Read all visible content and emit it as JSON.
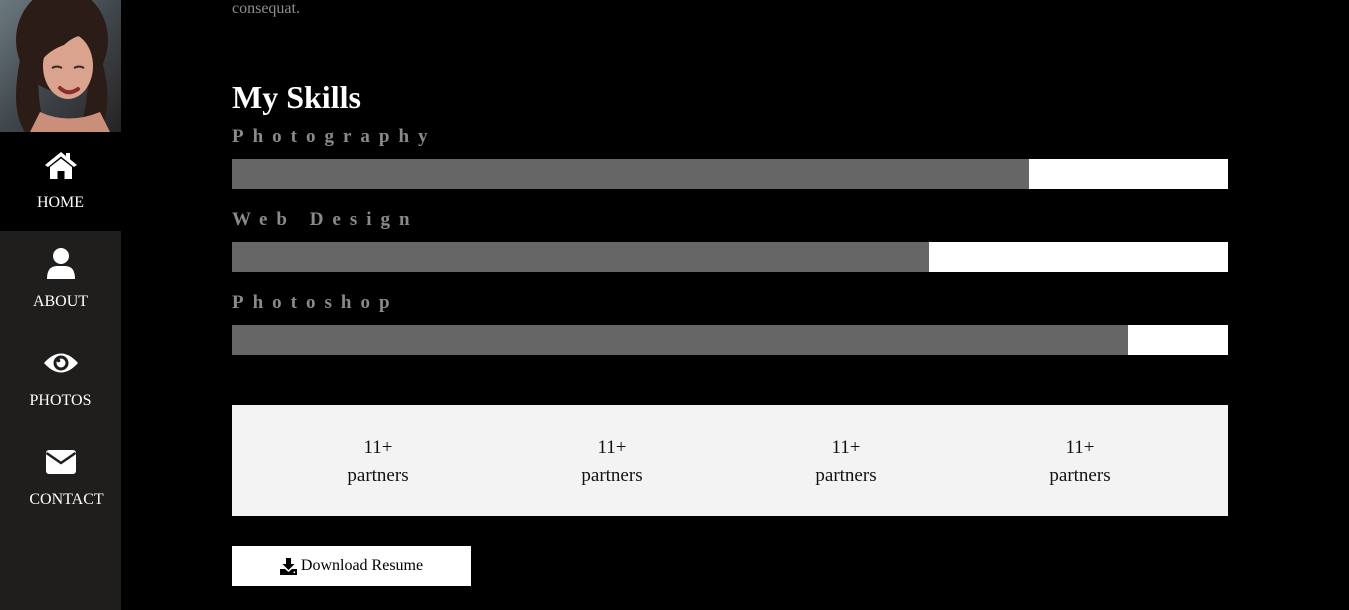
{
  "sidebar": {
    "avatar_alt": "Profile photo",
    "items": [
      {
        "label": "HOME",
        "icon": "home-icon",
        "active": true
      },
      {
        "label": "ABOUT",
        "icon": "user-icon",
        "active": false
      },
      {
        "label": "PHOTOS",
        "icon": "eye-icon",
        "active": false
      },
      {
        "label": "CONTACT",
        "icon": "envelope-icon",
        "active": false
      }
    ]
  },
  "about": {
    "intro_tail": "consequat."
  },
  "skills": {
    "title": "My Skills",
    "items": [
      {
        "name": "Photography",
        "percent": 80
      },
      {
        "name": "Web Design",
        "percent": 70
      },
      {
        "name": "Photoshop",
        "percent": 90
      }
    ]
  },
  "stats": [
    {
      "value": "11+",
      "label": "partners"
    },
    {
      "value": "11+",
      "label": "partners"
    },
    {
      "value": "11+",
      "label": "partners"
    },
    {
      "value": "11+",
      "label": "partners"
    }
  ],
  "download": {
    "label": "Download Resume",
    "icon": "download-icon"
  },
  "colors": {
    "sidebar_bg": "#1f1e1c",
    "active_bg": "#000000",
    "bar_fill": "#666666",
    "bar_track": "#ffffff",
    "stats_bg": "#f3f3f3"
  }
}
